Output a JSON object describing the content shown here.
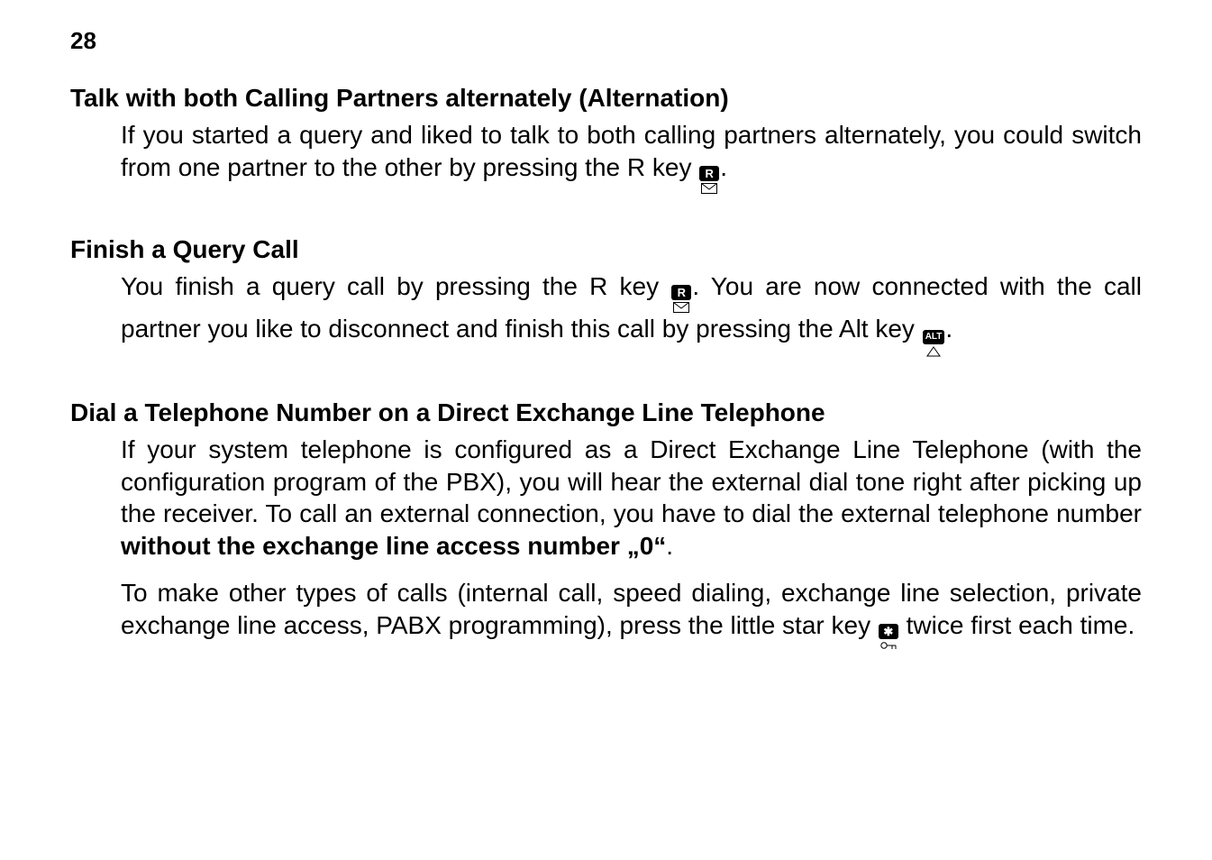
{
  "page_number": "28",
  "sections": {
    "alt": {
      "title": "Talk with both Calling Partners alternately (Alternation)",
      "p1a": "If you started a query and liked to talk to both calling partners alternately, you could switch from one partner to the other by pressing the R key ",
      "p1b": "."
    },
    "finish": {
      "title": "Finish a Query Call",
      "p1a": "You finish a query call by pressing the R key ",
      "p1b": ". You are now connected with the call partner you like to disconnect and finish this call by pressing the Alt key ",
      "p1c": "."
    },
    "direct": {
      "title": "Dial a Telephone Number on a Direct Exchange Line Telephone",
      "p1a": "If your system telephone is configured as a Direct Exchange Line Telephone (with the configuration program of the PBX), you will hear the external dial tone right after picking up the receiver. To call an external connection, you have to dial the external telephone number ",
      "p1bold": "without the exchange line access number „0“",
      "p1b": ".",
      "p2a": "To make other types of calls (internal call, speed dialing, exchange line selection, private exchange line access, PABX programming), press the little star key ",
      "p2b": " twice first each time."
    }
  },
  "icons": {
    "r": "R",
    "alt": "ALT",
    "star": "✱"
  }
}
